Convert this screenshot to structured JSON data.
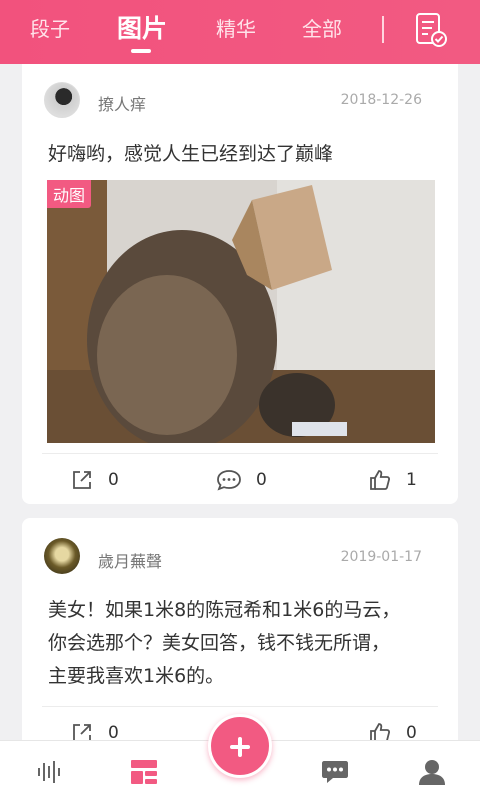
{
  "top_tabs": [
    {
      "label": "段子",
      "active": false
    },
    {
      "label": "图片",
      "active": true
    },
    {
      "label": "精华",
      "active": false
    },
    {
      "label": "全部",
      "active": false
    }
  ],
  "posts": [
    {
      "username": "撩人痒",
      "date": "2018-12-26",
      "text": "好嗨哟，感觉人生已经到达了巅峰",
      "media_badge": "动图",
      "shares": "0",
      "comments": "0",
      "likes": "1"
    },
    {
      "username": "歲月蕪聲 ",
      "date": "2019-01-17",
      "text_lines": [
        "美女！如果1米8的陈冠希和1米6的马云，",
        "你会选那个？美女回答，钱不钱无所谓，",
        "主要我喜欢1米6的。"
      ],
      "shares": "0",
      "likes": "0"
    }
  ],
  "colors": {
    "brand_pink": "#f25a82",
    "text_primary": "#333333",
    "text_secondary": "#777777"
  },
  "icons": {
    "top_right": "document-check-icon",
    "share": "share-icon",
    "comment": "comment-icon",
    "like": "thumbs-up-icon",
    "nav": [
      "audio-wave-icon",
      "feed-icon",
      "add-icon",
      "message-icon",
      "user-icon"
    ]
  }
}
